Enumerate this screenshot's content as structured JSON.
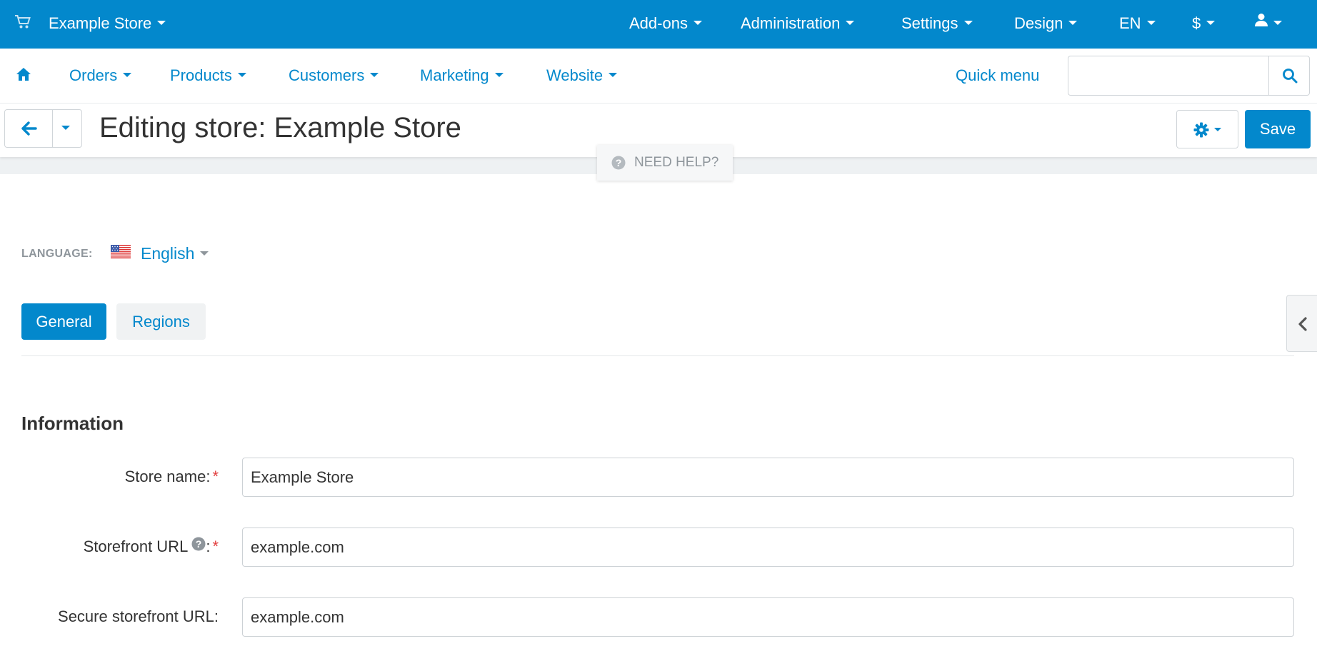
{
  "topbar": {
    "store_name": "Example Store",
    "menus": [
      "Add-ons",
      "Administration",
      "Settings",
      "Design",
      "EN",
      "$"
    ],
    "cart_icon": "cart-icon",
    "user_icon": "user-icon"
  },
  "navbar": {
    "home_icon": "home-icon",
    "items": [
      "Orders",
      "Products",
      "Customers",
      "Marketing",
      "Website"
    ],
    "quick_menu": "Quick menu",
    "search_placeholder": "",
    "search_icon": "search-icon"
  },
  "titlebar": {
    "title": "Editing store: Example Store",
    "save_label": "Save",
    "gear_icon": "gear-icon",
    "back_icon": "arrow-left-icon"
  },
  "help": {
    "label": "NEED HELP?",
    "icon": "question-circle-icon"
  },
  "language": {
    "label": "LANGUAGE:",
    "value": "English",
    "flag_icon": "us-flag-icon"
  },
  "tabs": [
    "General",
    "Regions"
  ],
  "form": {
    "section_title": "Information",
    "fields": [
      {
        "label": "Store name:",
        "value": "Example Store",
        "required": true
      },
      {
        "label": "Storefront URL",
        "value": "example.com",
        "required": true
      },
      {
        "label": "Secure storefront URL:",
        "value": "example.com",
        "required": false
      }
    ]
  },
  "colors": {
    "primary": "#0388cc",
    "required": "#e23b3b",
    "muted": "#8e959b"
  }
}
